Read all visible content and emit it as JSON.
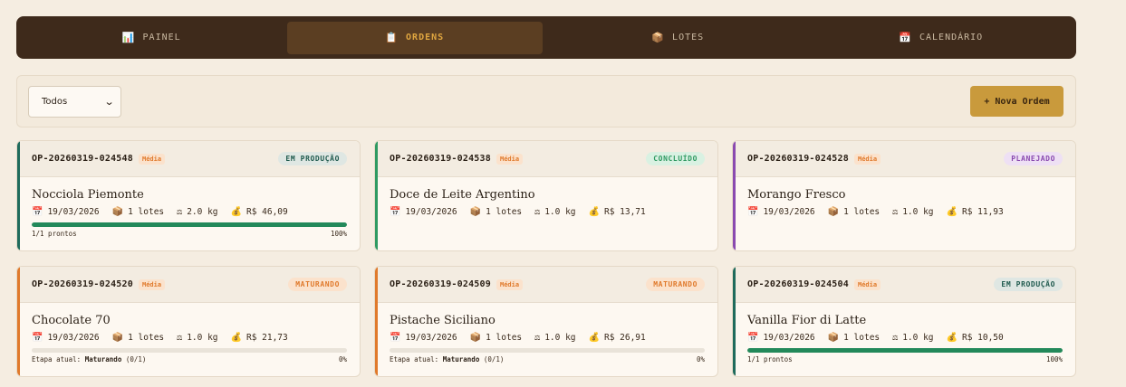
{
  "nav": {
    "tabs": [
      {
        "icon": "📊",
        "icon_name": "chart-icon",
        "label": "PAINEL"
      },
      {
        "icon": "📋",
        "icon_name": "clipboard-icon",
        "label": "ORDENS"
      },
      {
        "icon": "📦",
        "icon_name": "box-icon",
        "label": "LOTES"
      },
      {
        "icon": "📅",
        "icon_name": "calendar-icon",
        "label": "CALENDÁRIO"
      }
    ],
    "active_tab": "ORDENS"
  },
  "filter": {
    "selected": "Todos",
    "new_button": "+ Nova Ordem"
  },
  "icons": {
    "date": "📅",
    "lots": "📦",
    "weight": "⚖",
    "cost": "💰"
  },
  "colors": {
    "em_producao": "#1f6b5c",
    "concluido": "#2f9a62",
    "planejado": "#8a4ab0",
    "maturando": "#e07a2c",
    "progress": "#23895a"
  },
  "orders": [
    {
      "id": "OP-20260319-024548",
      "priority": "Média",
      "status": "EM PRODUÇÃO",
      "name": "Nocciola Piemonte",
      "date": "19/03/2026",
      "lots": "1 lotes",
      "weight": "2.0 kg",
      "cost": "R$ 46,09",
      "progress_left": "1/1 prontos",
      "progress_right": "100%",
      "progress": 1.0
    },
    {
      "id": "OP-20260319-024538",
      "priority": "Média",
      "status": "CONCLUÍDO",
      "name": "Doce de Leite Argentino",
      "date": "19/03/2026",
      "lots": "1 lotes",
      "weight": "1.0 kg",
      "cost": "R$ 13,71"
    },
    {
      "id": "OP-20260319-024528",
      "priority": "Média",
      "status": "PLANEJADO",
      "name": "Morango Fresco",
      "date": "19/03/2026",
      "lots": "1 lotes",
      "weight": "1.0 kg",
      "cost": "R$ 11,93"
    },
    {
      "id": "OP-20260319-024520",
      "priority": "Média",
      "status": "MATURANDO",
      "name": "Chocolate 70",
      "date": "19/03/2026",
      "lots": "1 lotes",
      "weight": "1.0 kg",
      "cost": "R$ 21,73",
      "progress_label": "Etapa atual:",
      "progress_stage": "Maturando",
      "progress_count": "(0/1)",
      "progress_right": "0%",
      "progress": 0.0
    },
    {
      "id": "OP-20260319-024509",
      "priority": "Média",
      "status": "MATURANDO",
      "name": "Pistache Siciliano",
      "date": "19/03/2026",
      "lots": "1 lotes",
      "weight": "1.0 kg",
      "cost": "R$ 26,91",
      "progress_label": "Etapa atual:",
      "progress_stage": "Maturando",
      "progress_count": "(0/1)",
      "progress_right": "0%",
      "progress": 0.0
    },
    {
      "id": "OP-20260319-024504",
      "priority": "Média",
      "status": "EM PRODUÇÃO",
      "name": "Vanilla Fior di Latte",
      "date": "19/03/2026",
      "lots": "1 lotes",
      "weight": "1.0 kg",
      "cost": "R$ 10,50",
      "progress_left": "1/1 prontos",
      "progress_right": "100%",
      "progress": 1.0
    }
  ]
}
